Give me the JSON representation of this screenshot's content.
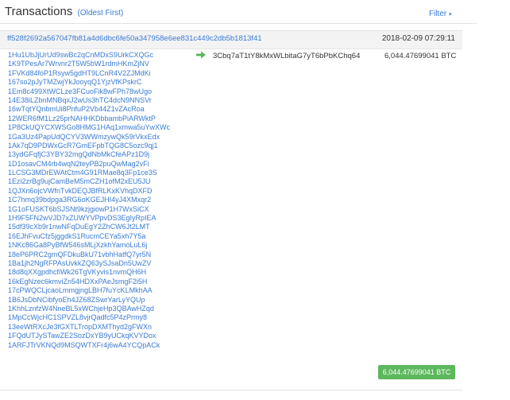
{
  "header": {
    "title": "Transactions",
    "subtitle": "(Oldest First)",
    "filter_label": "Filter"
  },
  "transaction": {
    "hash": "ff528f2692a567047fb81a4d6dbc6fe50a347958e6ee831c449c2db5b1813f41",
    "date": "2018-02-09 07:29:11",
    "inputs": [
      "1Hu1UbJjUrUd9swBc2qCnMDxS9UrkCXQGc",
      "1K9TPesAr7Wrvnr2T5W5bW1rdmHKmZjNV",
      "1FVKd84foP1Rsyw5gdHT9LCnR4V2ZJMdKi",
      "167so2pJyTMZwjYkJooyqQ1YjzVfKPskrC",
      "1Em8c499XtWCLze3FCuoFik8wFPh78wUgo",
      "14E38iLZbnMNBqxJ2wUs3hTC4dcN9NNSVr",
      "16wTqtYQnbmUi8PnfuP2Vb44Z1vZAcRoa",
      "12WER6fM1Lz25prNAHHKDbbambPiARWktP",
      "1P8CkUQYCXWSGo8HMG1HAq1xmwa5uYwXWc",
      "1Ga3Uz4PapUdQCYV3WWmzywQk59rVkxEdx",
      "1Ak7qD9PDWxGcR7GmEFpbTQG8C5ozc9qj1",
      "13ydGFqfjC3YBY32mgQdNbMkCfeAPz1D9j",
      "1D1osavCM4rb4wqN2teyPB2puQwMag2vFi",
      "1LCSG3MDrEWAtCtm4G91RMae8q3Fp1ce3S",
      "1Ezi2zrBg9ujCamBeM5mCZH1ofM2xEU5JU",
      "1QJXn6ojcVWfnTvkDEQJBfRLKxKVhqDXFD",
      "1C7hmq39bdpga3RG6oKGEJHI4yJ4XMxqr2",
      "1G1oFUSKT6bSJSNt9kzjgiowP1H7WxSiCX",
      "1H9F5FN2wVJD7xZUWYVPpvDS3EgIyRpIEA",
      "15df39cXb9r1nwNFqDuEgY2ZhCW6Jt2LMT",
      "16EJhFvuCfz5jggdkS1RucmCEYa5xh7Y5a",
      "1NKc86Ga8PyBfW546sMLjXzkhYamoLuL6j",
      "18eP6PRC2gmQFDkuBkU71vbhHatfQ7yr5N",
      "1Ba1jh2NgRFPAsUvkkZQ63ySJsaDn5UwZV",
      "18d8qXXgpdhcfiWk26TgVKyvis1nvmQH6H",
      "16kEgNzec6kmviZn54HDXxPAeJsmgF2i5H",
      "17cPWQCLjcaoLmmgjngLBH7fuYcKLMkhAA",
      "1B6JsDbNCibfyoEh4JZ68ZSwrYarLyYQUp",
      "1KhhLznfzW4NneBL5xWChjeHp3QBAwHZqd",
      "1MpCcWjcHC1SPVZL8vjrQadfc5P4zPrmy8",
      "13eeWtRXcJe3fGXTLTropDXMThyd2gFWXn",
      "1FQdUTJySTawZE2SozDxYB9yUCkqKVYDox",
      "1ARFJTrVKNQd9MSQWTXFr4j6wA4YCQpACk"
    ],
    "output_address": "3Cbq7aT1tY8kMxWLbitaG7yT6bPbKChq64",
    "output_amount": "6,044.47699041 BTC",
    "total": "6,044.47699041 BTC"
  },
  "icons": {
    "filter_caret": "caret-down-icon",
    "flow_arrow": "right-arrow-icon"
  },
  "colors": {
    "link": "#3a7bd5",
    "arrow": "#5cb85c",
    "total_bg": "#5cb85c"
  }
}
